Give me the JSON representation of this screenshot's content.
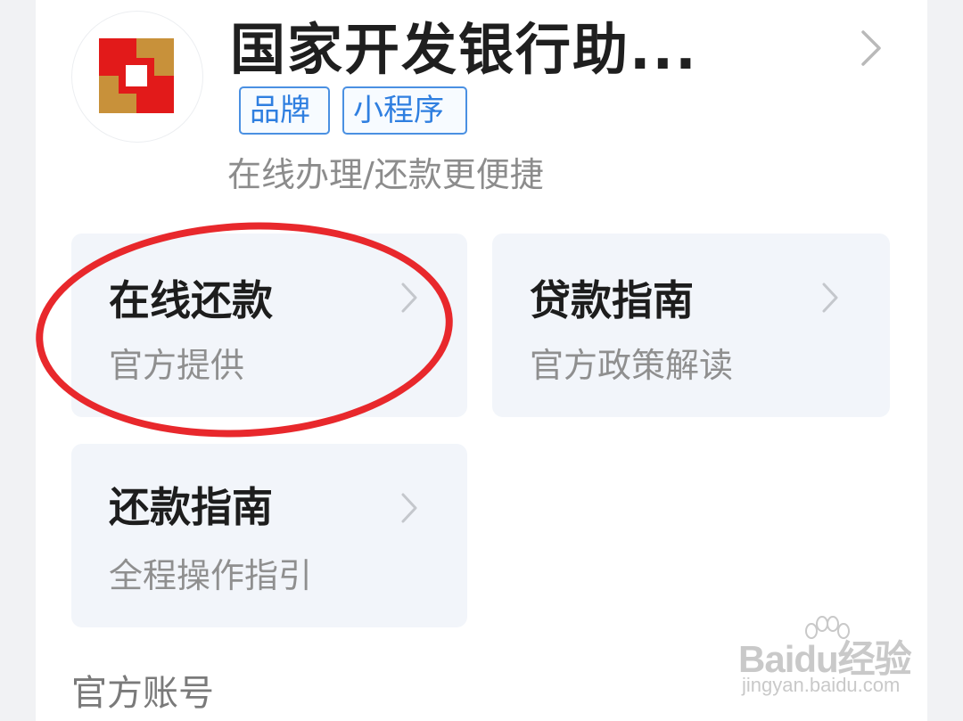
{
  "app": {
    "title": "国家开发银行助...",
    "tags": [
      "品牌",
      "小程序"
    ],
    "description": "在线办理/还款更便捷"
  },
  "services": [
    {
      "title": "在线还款",
      "subtitle": "官方提供"
    },
    {
      "title": "贷款指南",
      "subtitle": "官方政策解读"
    },
    {
      "title": "还款指南",
      "subtitle": "全程操作指引"
    }
  ],
  "section": {
    "label": "官方账号"
  },
  "watermark": {
    "logo": "Baidu经验",
    "url": "jingyan.baidu.com"
  },
  "colors": {
    "tag_blue": "#2f7fe0",
    "highlight_red": "#e8282c",
    "tile_bg": "#f2f5fa",
    "logo_red": "#e21a1a",
    "logo_gold": "#c8913a"
  },
  "icons": [
    "cdb-logo-icon",
    "chevron-right-icon",
    "paw-icon"
  ]
}
